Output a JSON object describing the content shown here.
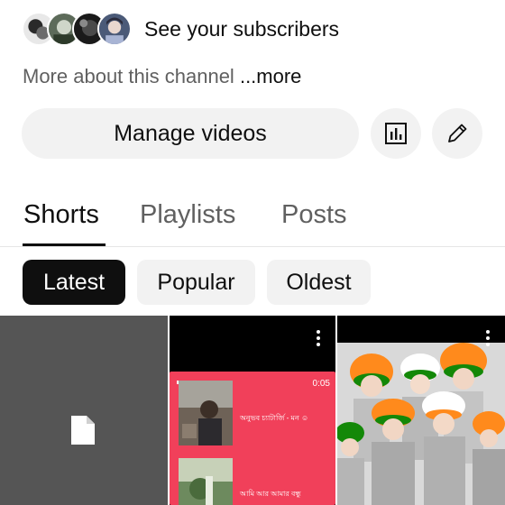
{
  "channel": {
    "subscribers_label": "See your subscribers",
    "more_about": "More about this channel",
    "more_link": "...more"
  },
  "actions": {
    "manage_videos_label": "Manage videos",
    "analytics_icon": "analytics-icon",
    "edit_icon": "pencil-icon"
  },
  "tabs": [
    {
      "label": "Shorts",
      "active": true
    },
    {
      "label": "Playlists",
      "active": false
    },
    {
      "label": "Posts",
      "active": false
    }
  ],
  "filters": [
    {
      "label": "Latest",
      "active": true
    },
    {
      "label": "Popular",
      "active": false
    },
    {
      "label": "Oldest",
      "active": false
    }
  ],
  "shorts": [
    {
      "kind": "processing",
      "icon": "document-icon"
    },
    {
      "kind": "video",
      "duration": "0:05",
      "captions": [
        "অনুভব চ্যাটার্জি - মন ☺",
        "আমি আর আমার বন্ধু"
      ]
    },
    {
      "kind": "image",
      "theme_colors": [
        "#ff8a1c",
        "#ffffff",
        "#138808"
      ]
    }
  ],
  "colors": {
    "text_primary": "#0f0f0f",
    "text_secondary": "#606060",
    "chip_bg": "#f2f2f2",
    "chip_active_bg": "#0f0f0f",
    "card_accent": "#f1405a"
  }
}
